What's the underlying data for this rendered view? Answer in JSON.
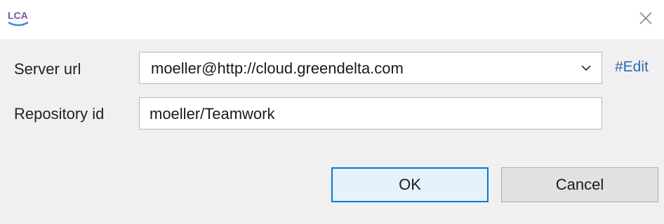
{
  "window": {
    "app_logo_text": "LCA",
    "close_icon": "close-icon"
  },
  "form": {
    "server_url_label": "Server url",
    "server_url_value": "moeller@http://cloud.greendelta.com",
    "dropdown_icon": "chevron-down-icon",
    "edit_link": "#Edit",
    "repository_id_label": "Repository id",
    "repository_id_value": "moeller/Teamwork"
  },
  "buttons": {
    "ok_label": "OK",
    "cancel_label": "Cancel"
  },
  "colors": {
    "link": "#2b6cb0",
    "logo_accent": "#7b4fa8",
    "default_button_border": "#0078d7"
  }
}
